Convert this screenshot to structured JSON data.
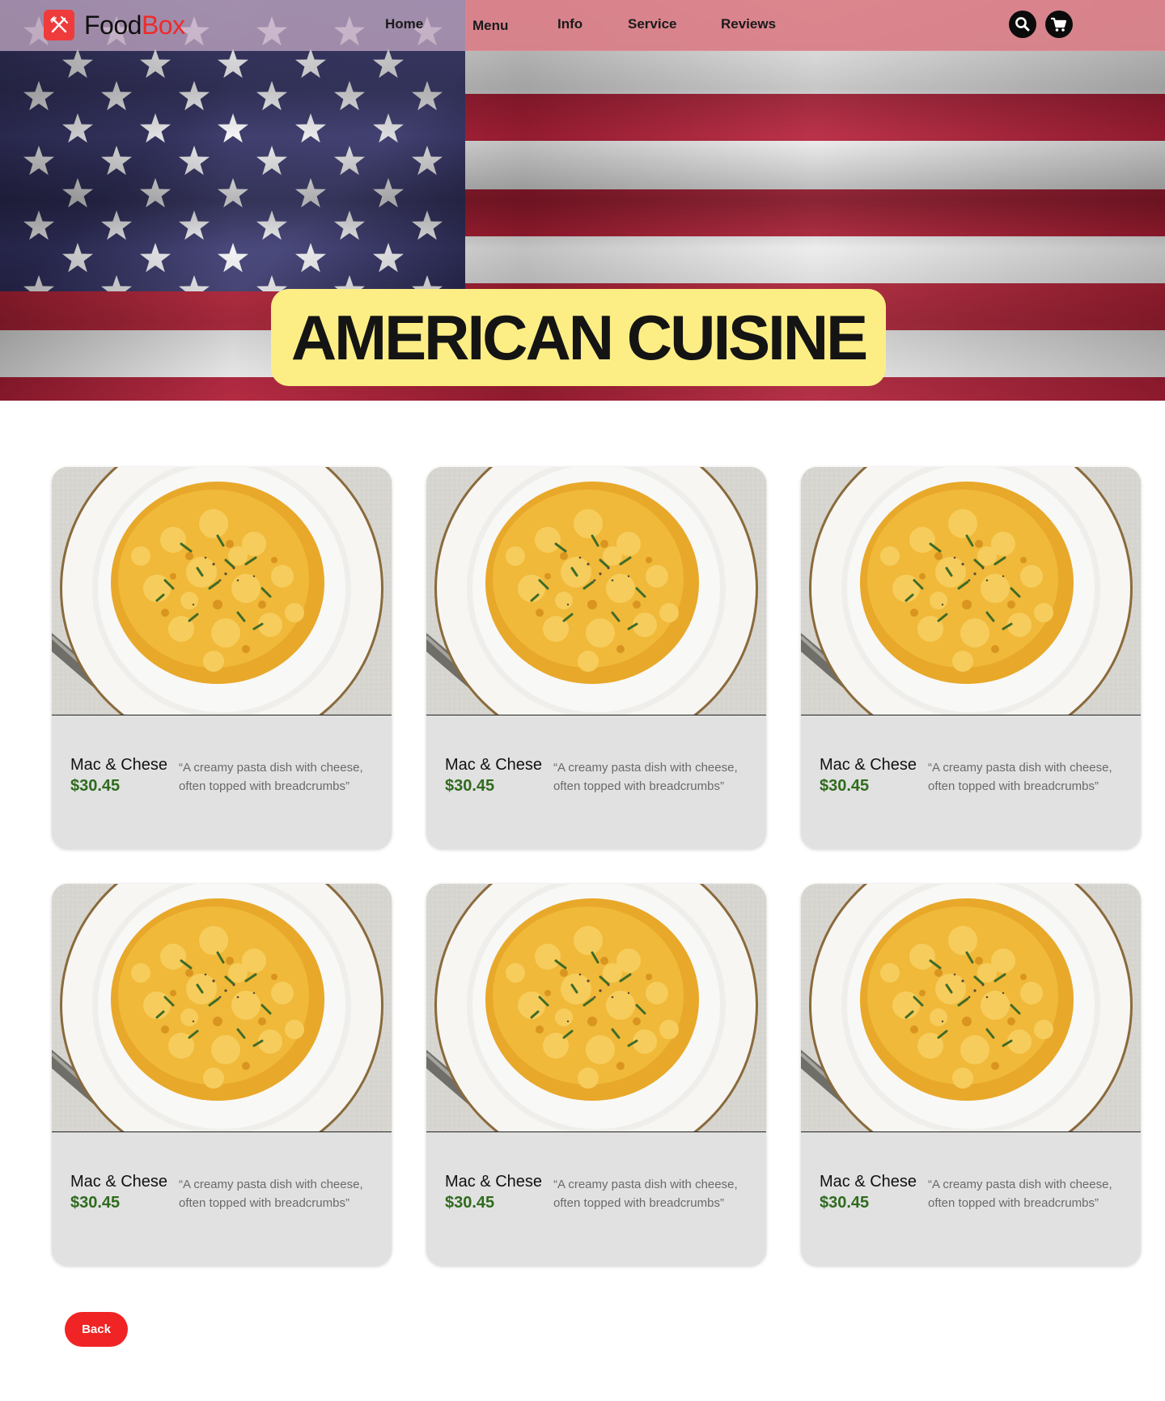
{
  "brand": {
    "name_part1": "Food",
    "name_part2": "Box"
  },
  "nav": {
    "links": [
      {
        "label": "Home"
      },
      {
        "label": "Menu"
      },
      {
        "label": "Info"
      },
      {
        "label": "Service"
      },
      {
        "label": "Reviews"
      }
    ],
    "icons": [
      "search-icon",
      "cart-icon"
    ]
  },
  "hero": {
    "title": "AMERICAN CUISINE",
    "background": "us-flag"
  },
  "colors": {
    "accent_red": "#f02424",
    "title_highlight": "#fcee85",
    "price_green": "#2f6b1e",
    "card_bg": "#e1e1e1"
  },
  "menu_items": [
    {
      "name": "Mac & Chese",
      "price": "$30.45",
      "description": "“A creamy pasta dish with cheese, often topped with breadcrumbs”"
    },
    {
      "name": "Mac & Chese",
      "price": "$30.45",
      "description": "“A creamy pasta dish with cheese, often topped with breadcrumbs”"
    },
    {
      "name": "Mac & Chese",
      "price": "$30.45",
      "description": "“A creamy pasta dish with cheese, often topped with breadcrumbs”"
    },
    {
      "name": "Mac & Chese",
      "price": "$30.45",
      "description": "“A creamy pasta dish with cheese, often topped with breadcrumbs”"
    },
    {
      "name": "Mac & Chese",
      "price": "$30.45",
      "description": "“A creamy pasta dish with cheese, often topped with breadcrumbs”"
    },
    {
      "name": "Mac & Chese",
      "price": "$30.45",
      "description": "“A creamy pasta dish with cheese, often topped with breadcrumbs”"
    }
  ],
  "back_button": {
    "label": "Back"
  }
}
